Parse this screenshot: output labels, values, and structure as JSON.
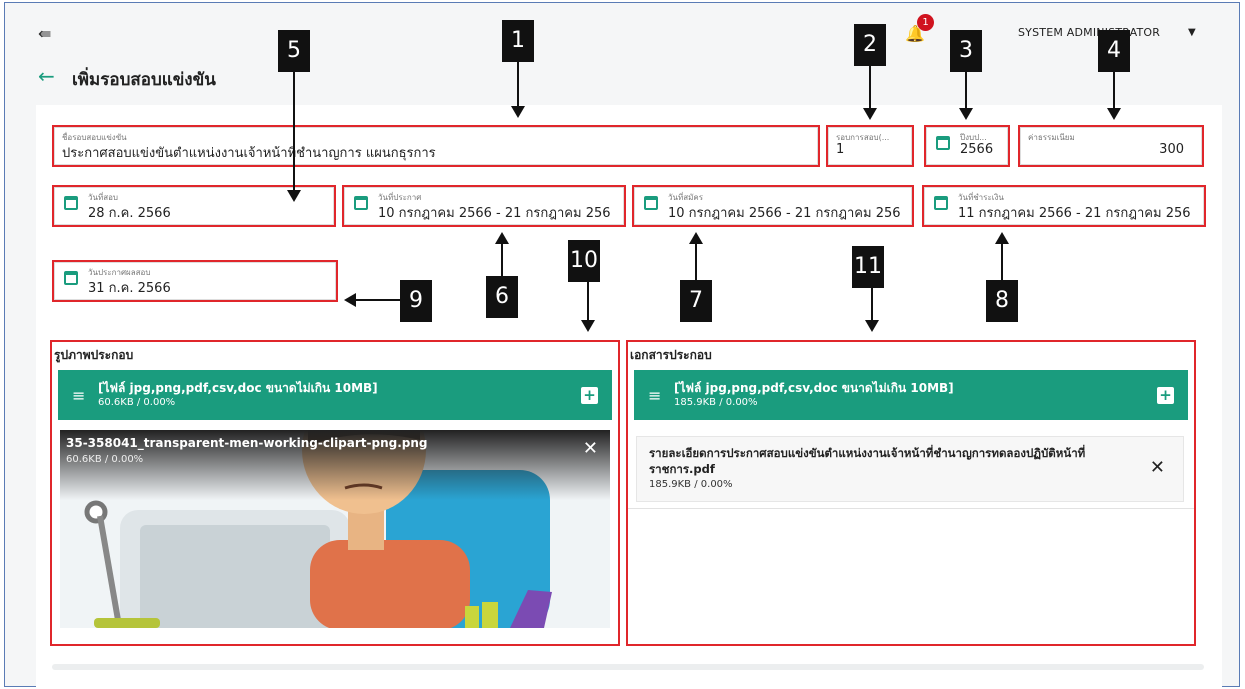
{
  "header": {
    "collapse_icon": "collapse-left-icon",
    "back_icon": "arrow-left-icon",
    "title": "เพิ่มรอบสอบแข่งขัน",
    "notification_count": "1",
    "user_name": "SYSTEM ADMINISTRATOR",
    "user_menu_icon": "caret-down-icon"
  },
  "form": {
    "exam_name": {
      "label": "ชื่อรอบสอบแข่งขัน",
      "value": "ประกาศสอบแข่งขันตำแหน่งงานเจ้าหน้าที่ชำนาญการ แผนกธุรการ"
    },
    "exam_round": {
      "label": "รอบการสอบ(...",
      "value": "1"
    },
    "budget_year": {
      "label": "ปีงบป...",
      "value": "2566"
    },
    "fee": {
      "label": "ค่าธรรมเนียม",
      "value": "300"
    },
    "exam_date": {
      "label": "วันที่สอบ",
      "value": "28 ก.ค. 2566"
    },
    "announce_date": {
      "label": "วันที่ประกาศ",
      "value": "10 กรกฎาคม 2566 - 21 กรกฎาคม 256"
    },
    "apply_date": {
      "label": "วันที่สมัคร",
      "value": "10 กรกฎาคม 2566 - 21 กรกฎาคม 256"
    },
    "payment_date": {
      "label": "วันที่ชำระเงิน",
      "value": "11 กรกฎาคม 2566 - 21 กรกฎาคม 256"
    },
    "result_date": {
      "label": "วันประกาศผลสอบ",
      "value": "31 ก.ค. 2566"
    }
  },
  "images_section": {
    "title": "รูปภาพประกอบ",
    "upload_title": "[ไฟล์ jpg,png,pdf,csv,doc ขนาดไม่เกิน 10MB]",
    "upload_size": "60.6KB / 0.00%",
    "file": {
      "name": "35-358041_transparent-men-working-clipart-png.png",
      "size": "60.6KB / 0.00%"
    }
  },
  "documents_section": {
    "title": "เอกสารประกอบ",
    "upload_title": "[ไฟล์ jpg,png,pdf,csv,doc ขนาดไม่เกิน 10MB]",
    "upload_size": "185.9KB / 0.00%",
    "file": {
      "name": "รายละเอียดการประกาศสอบแข่งขันตำแหน่งงานเจ้าหน้าที่ชำนาญการทดลองปฏิบัติหน้าที่ราชการ.pdf",
      "size": "185.9KB / 0.00%"
    }
  },
  "callouts": [
    "1",
    "2",
    "3",
    "4",
    "5",
    "6",
    "7",
    "8",
    "9",
    "10",
    "11"
  ],
  "colors": {
    "accent": "#1a9c7e",
    "highlight": "#e0262b",
    "badge": "#d0131f"
  }
}
